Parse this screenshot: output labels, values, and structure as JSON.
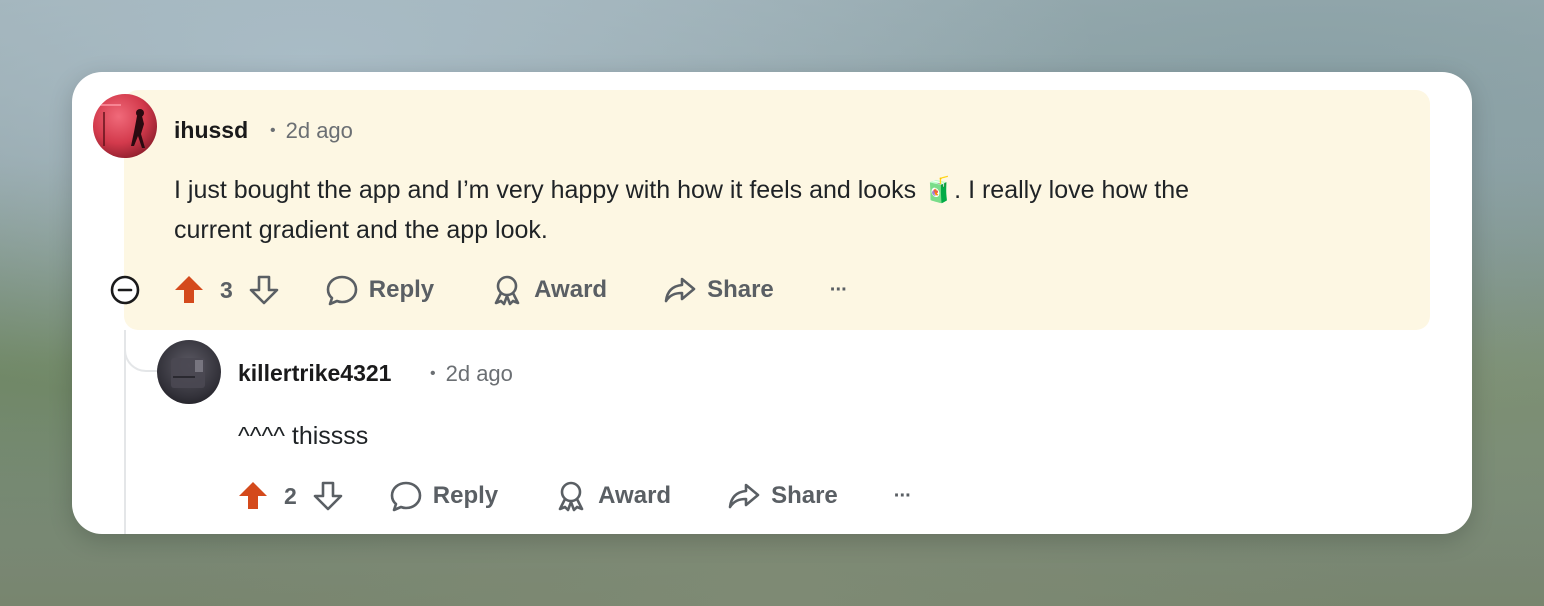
{
  "comment": {
    "username": "ihussd",
    "separator": "•",
    "time": "2d ago",
    "text_line1": "I just bought the app and I’m very happy with how it feels and looks 🧃. I really love how the",
    "text_line2": "current gradient and the app look.",
    "score": "3",
    "reply_label": "Reply",
    "award_label": "Award",
    "share_label": "Share",
    "more_label": "···",
    "upvoted": true,
    "highlight_color": "#fdf7e3"
  },
  "reply": {
    "username": "killertrike4321",
    "separator": "•",
    "time": "2d ago",
    "text": "^^^^ thissss",
    "score": "2",
    "reply_label": "Reply",
    "award_label": "Award",
    "share_label": "Share",
    "more_label": "···",
    "upvoted": true
  },
  "colors": {
    "upvote": "#d44a1c",
    "action_text": "#5a5f64",
    "meta_text": "#6b6f73"
  },
  "icons": {
    "collapse": "minus-circle-icon",
    "upvote": "arrow-up-icon",
    "downvote": "arrow-down-icon",
    "reply": "speech-bubble-icon",
    "award": "award-ribbon-icon",
    "share": "share-arrow-icon",
    "more": "ellipsis-icon"
  }
}
